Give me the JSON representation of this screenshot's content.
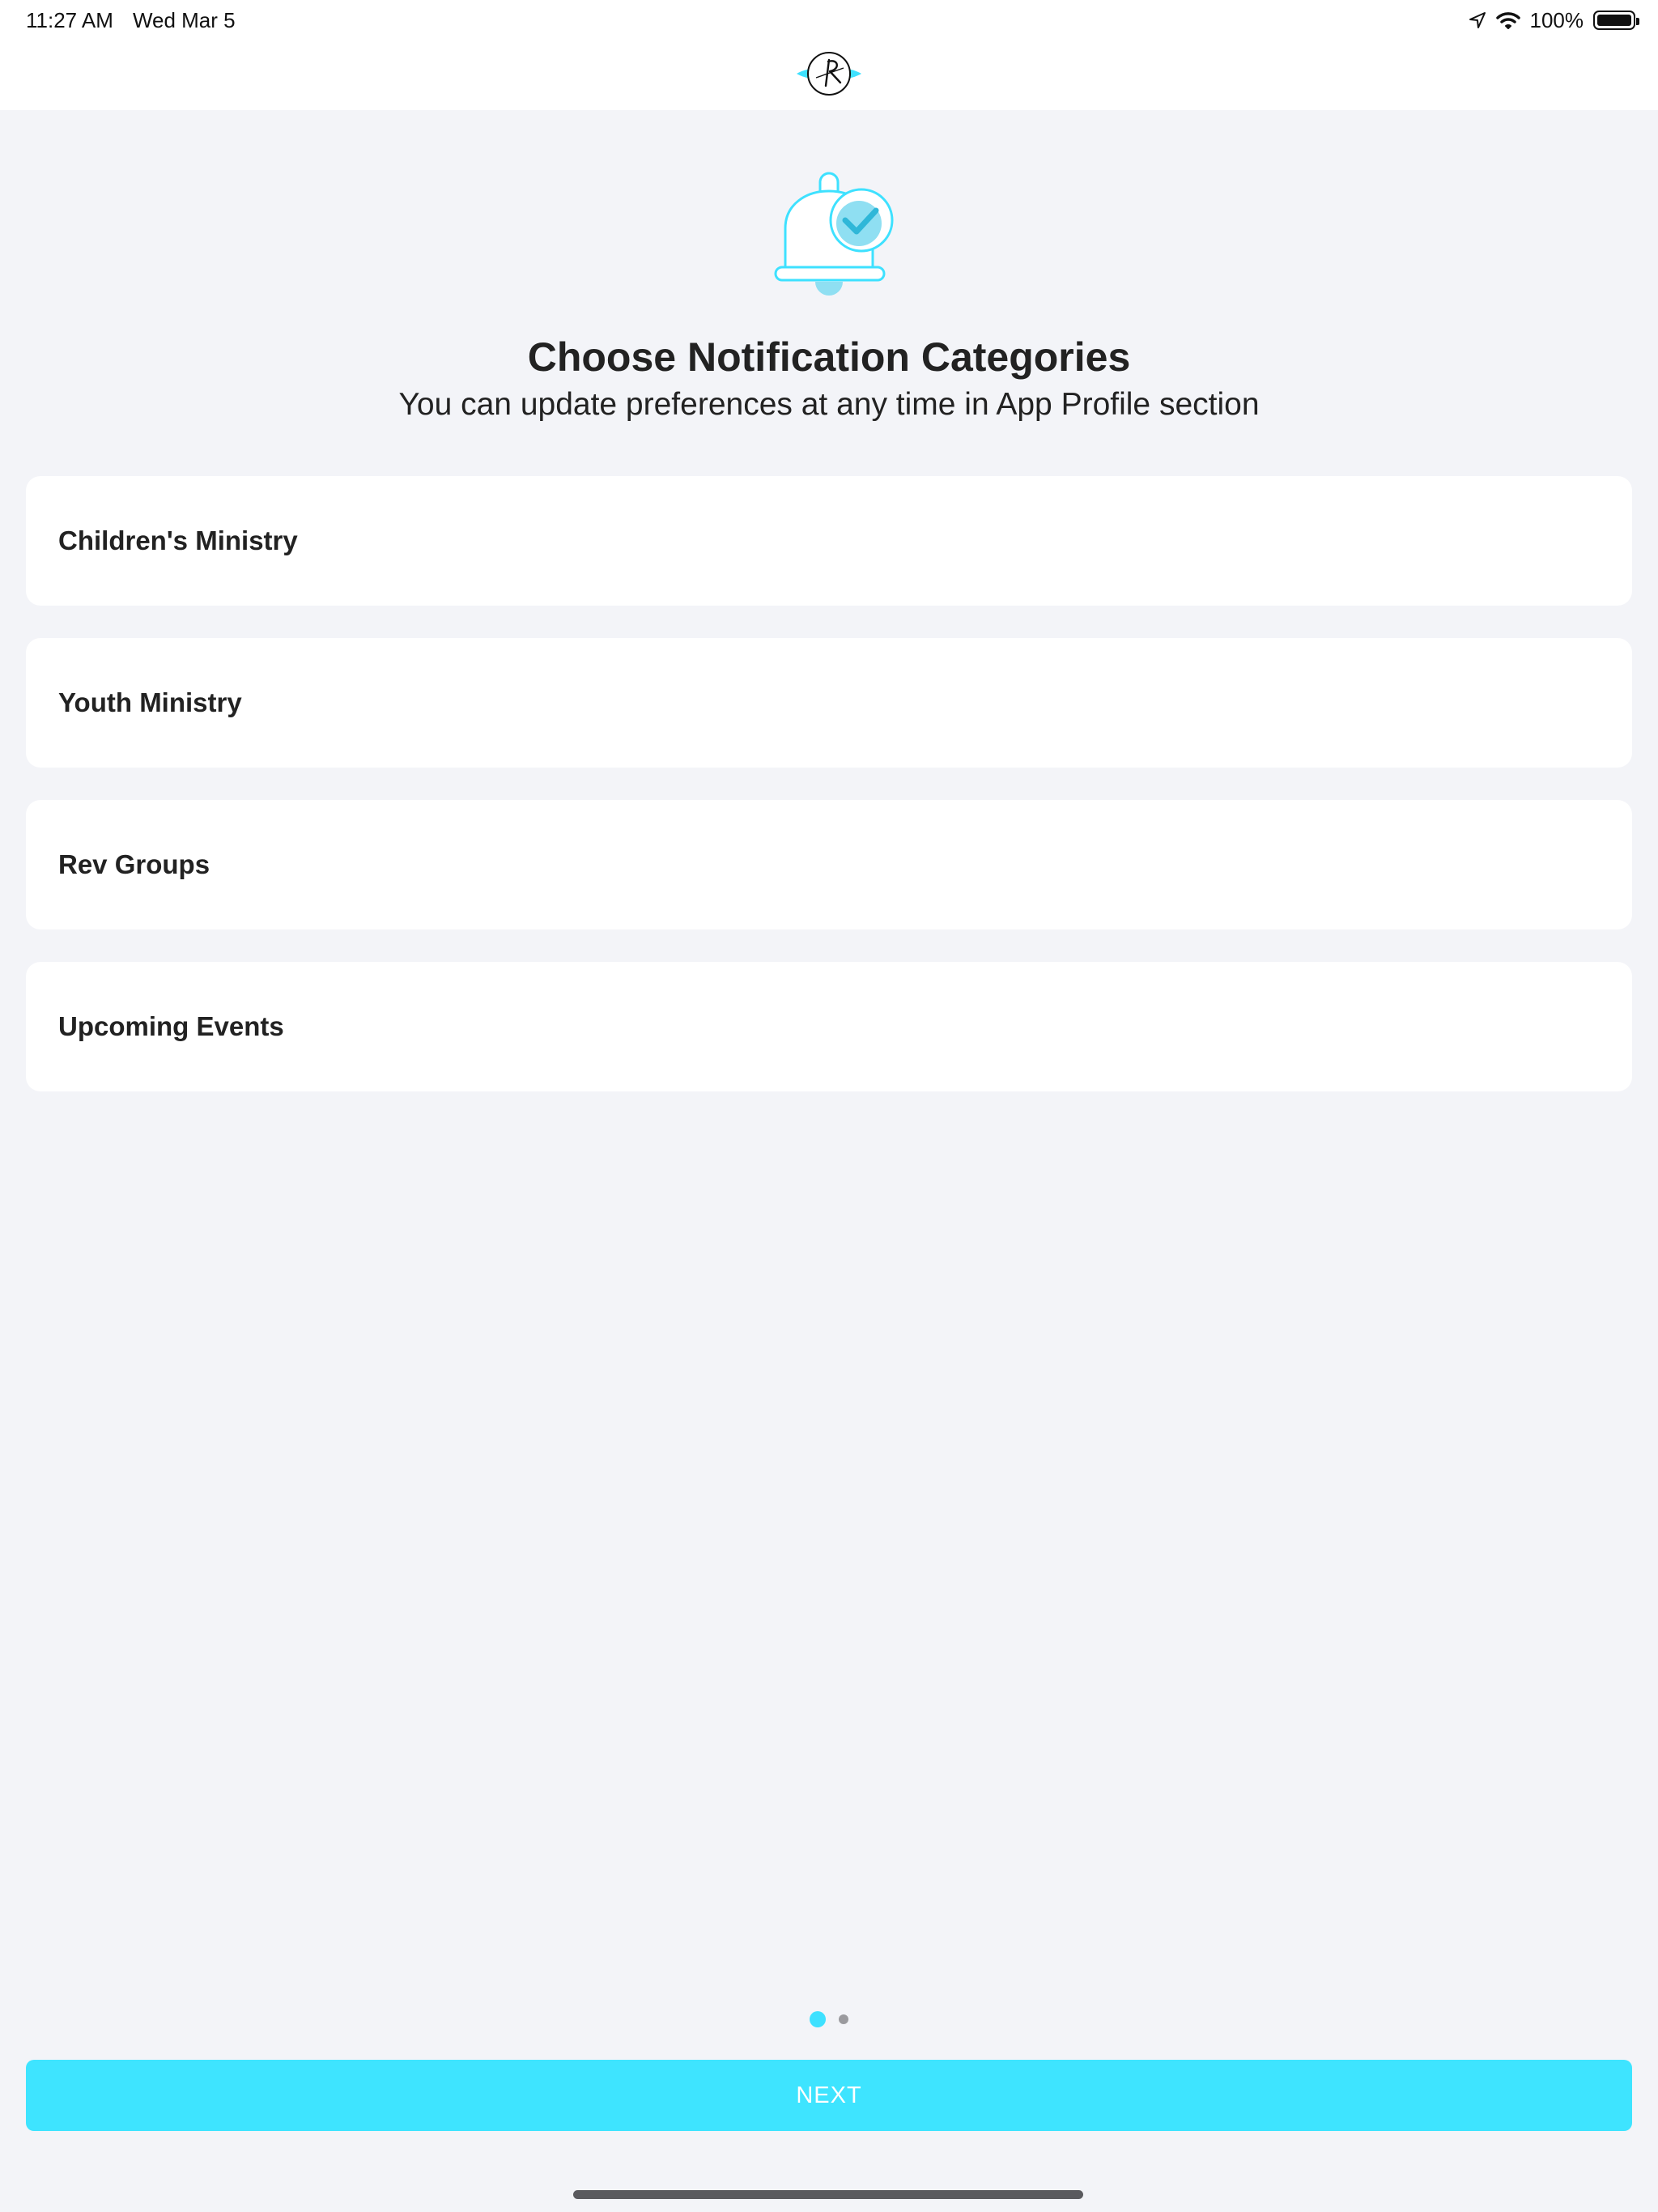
{
  "status_bar": {
    "time": "11:27 AM",
    "date": "Wed Mar 5",
    "battery": "100%",
    "icons": [
      "location-arrow-icon",
      "wifi-icon",
      "battery-icon"
    ]
  },
  "header": {
    "logo_icon": "church-logo-icon"
  },
  "hero": {
    "icon": "bell-check-icon",
    "title": "Choose Notification Categories",
    "subtitle": "You can update preferences at any time in App Profile section"
  },
  "categories": [
    {
      "label": "Children's Ministry"
    },
    {
      "label": "Youth Ministry"
    },
    {
      "label": "Rev Groups"
    },
    {
      "label": "Upcoming Events"
    }
  ],
  "pager": {
    "current_page": 1,
    "total_pages": 2
  },
  "footer": {
    "next_label": "NEXT"
  },
  "colors": {
    "accent": "#3EE4FF",
    "background": "#F3F4F8",
    "card": "#FFFFFF",
    "text": "#222222"
  }
}
